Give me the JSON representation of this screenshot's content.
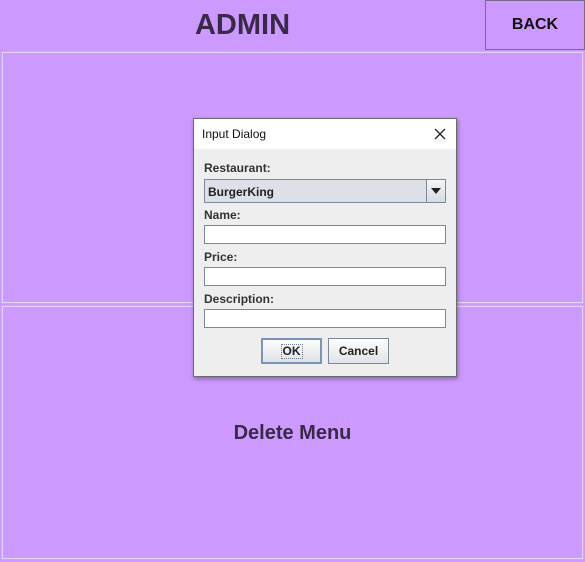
{
  "header": {
    "title": "ADMIN",
    "back_label": "BACK"
  },
  "main": {
    "delete_label": "Delete Menu"
  },
  "dialog": {
    "title": "Input Dialog",
    "restaurant_label": "Restaurant:",
    "restaurant_selected": "BurgerKing",
    "name_label": "Name:",
    "name_value": "",
    "price_label": "Price:",
    "price_value": "",
    "description_label": "Description:",
    "description_value": "",
    "ok_label": "OK",
    "cancel_label": "Cancel",
    "close_icon": "close-icon",
    "dropdown_icon": "chevron-down-icon"
  },
  "colors": {
    "background": "#cc99ff",
    "dialog_bg": "#eeeeee"
  }
}
